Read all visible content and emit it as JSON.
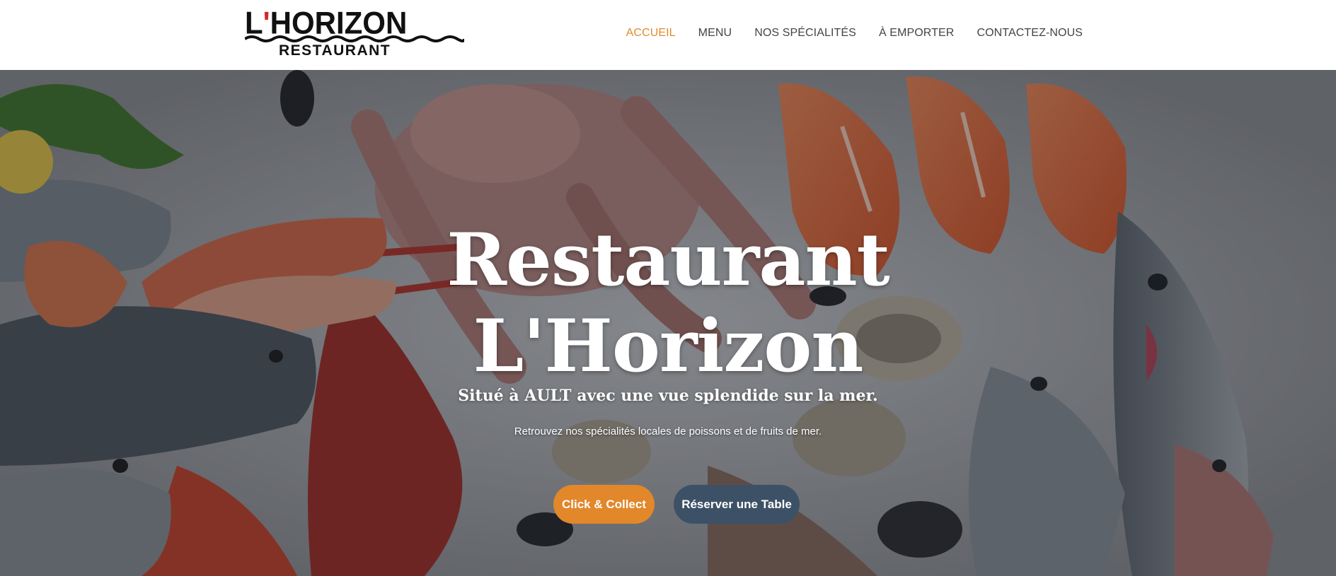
{
  "logo": {
    "line1_part1": "L",
    "line1_apostrophe": "'",
    "line1_part2": "HORIZON",
    "line2": "RESTAURANT"
  },
  "nav": {
    "items": [
      {
        "label": "ACCUEIL",
        "active": true
      },
      {
        "label": "MENU",
        "active": false
      },
      {
        "label": "NOS SPÉCIALITÉS",
        "active": false
      },
      {
        "label": "À EMPORTER",
        "active": false
      },
      {
        "label": "CONTACTEZ-NOUS",
        "active": false
      }
    ]
  },
  "hero": {
    "title_line1": "Restaurant",
    "title_line2": "L'Horizon",
    "subtitle": "Situé à AULT avec une vue splendide sur la mer.",
    "text": "Retrouvez nos spécialités locales de poissons et de fruits de mer.",
    "button_collect": "Click & Collect",
    "button_reserve": "Réserver une Table"
  },
  "colors": {
    "accent": "#e08a2c",
    "button_collect": "#e2872a",
    "button_reserve": "#3d5166",
    "logo_apostrophe": "#d62828"
  }
}
